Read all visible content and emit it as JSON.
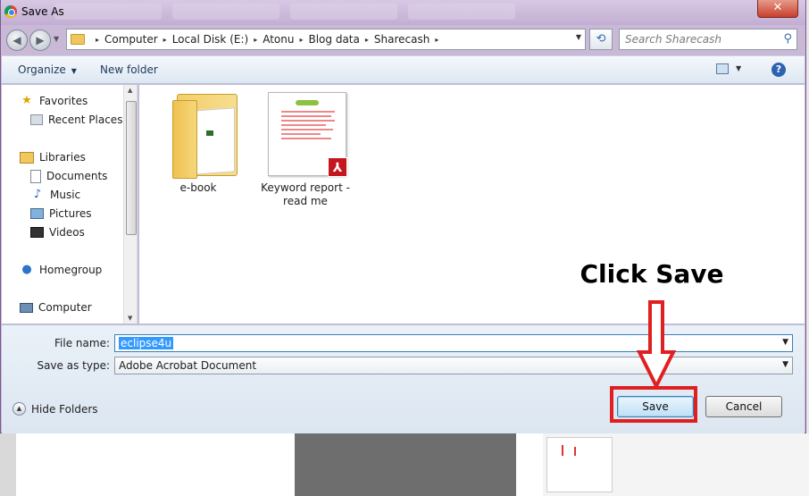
{
  "window": {
    "title": "Save As",
    "close_glyph": "✕"
  },
  "nav_buttons": {
    "back_glyph": "◀",
    "forward_glyph": "▶"
  },
  "address": {
    "segments": [
      "Computer",
      "Local Disk (E:)",
      "Atonu",
      "Blog data",
      "Sharecash"
    ],
    "separator": "▸"
  },
  "search": {
    "placeholder": "Search Sharecash",
    "icon": "search-icon"
  },
  "toolbar": {
    "organize_label": "Organize",
    "new_folder_label": "New folder",
    "help_label": "?"
  },
  "nav_pane": {
    "items": [
      {
        "label": "Favorites",
        "icon": "star-icon",
        "level": 0
      },
      {
        "label": "Recent Places",
        "icon": "recent-places-icon",
        "level": 1
      },
      {
        "label": "Libraries",
        "icon": "library-icon",
        "level": 0
      },
      {
        "label": "Documents",
        "icon": "documents-icon",
        "level": 1
      },
      {
        "label": "Music",
        "icon": "music-icon",
        "level": 1
      },
      {
        "label": "Pictures",
        "icon": "pictures-icon",
        "level": 1
      },
      {
        "label": "Videos",
        "icon": "videos-icon",
        "level": 1
      },
      {
        "label": "Homegroup",
        "icon": "homegroup-icon",
        "level": 0
      },
      {
        "label": "Computer",
        "icon": "computer-icon",
        "level": 0
      }
    ]
  },
  "files": [
    {
      "name": "e-book",
      "type": "folder",
      "icon": "folder-icon"
    },
    {
      "name": "Keyword report - read me",
      "type": "pdf",
      "icon": "pdf-file-icon"
    }
  ],
  "form": {
    "file_name_label": "File name:",
    "file_name_value": "eclipse4u",
    "save_type_label": "Save as type:",
    "save_type_value": "Adobe Acrobat Document",
    "hide_folders_label": "Hide Folders",
    "save_label": "Save",
    "cancel_label": "Cancel"
  },
  "annotation": {
    "text": "Click Save",
    "highlight_color": "#e02020"
  },
  "colors": {
    "title_bar": "#c9b8d6",
    "selection": "#3399ff",
    "annotation_red": "#e02020"
  }
}
